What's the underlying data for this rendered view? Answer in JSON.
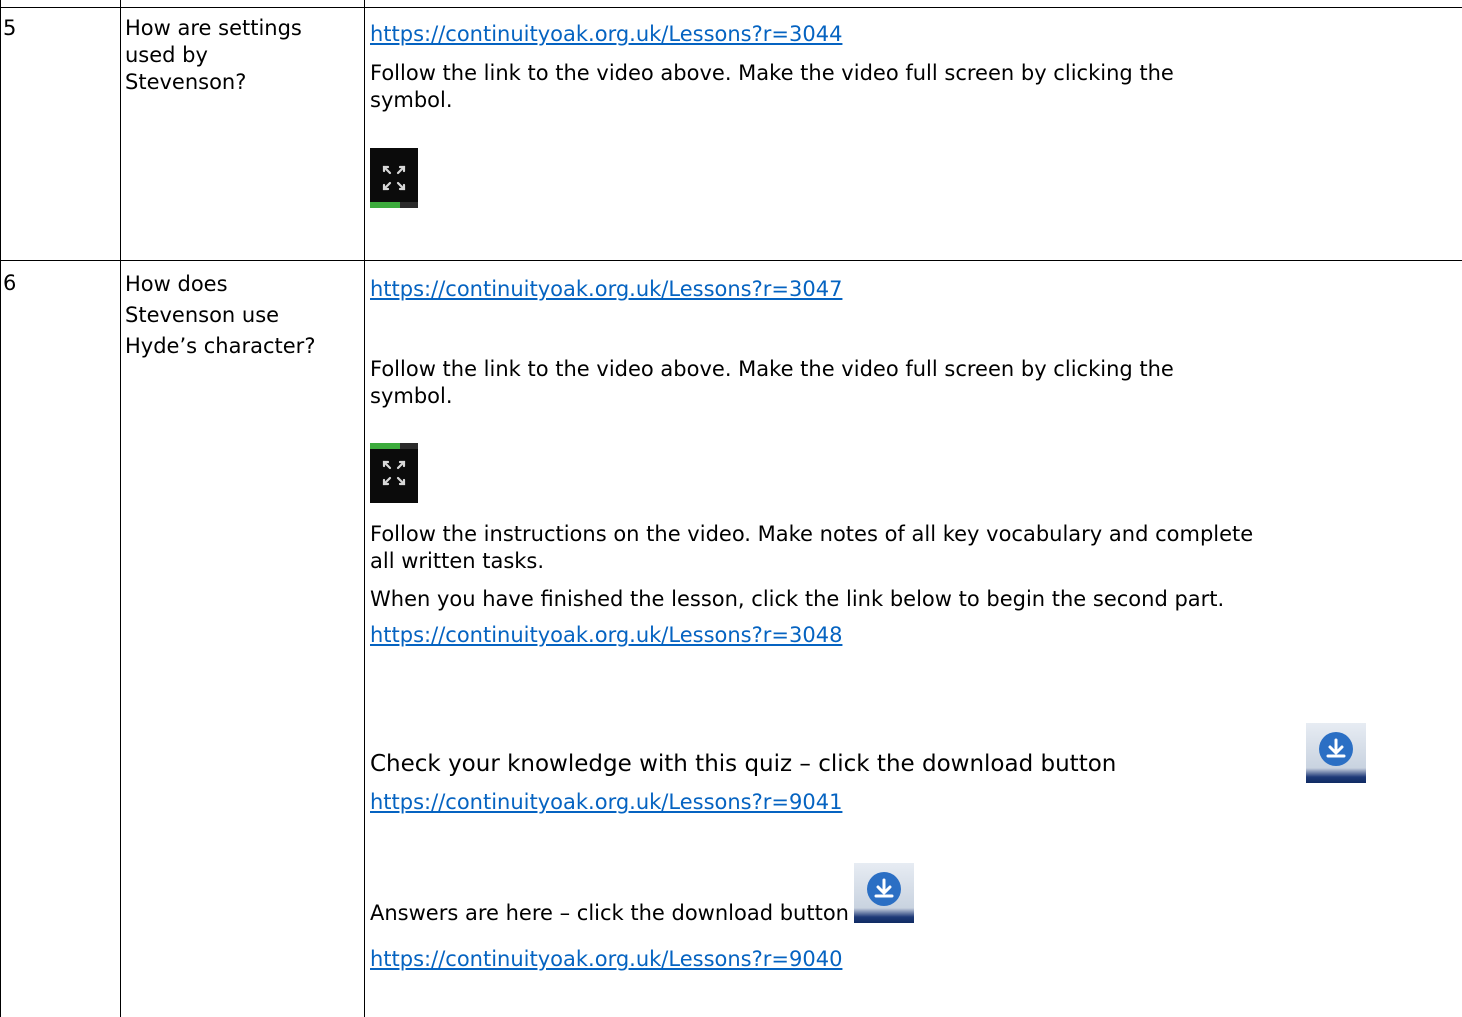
{
  "rows": [
    {
      "number": "5",
      "question": [
        "How are settings",
        "used by",
        "Stevenson?"
      ],
      "link": "https://continuityoak.org.uk/Lessons?r=3044",
      "instruction": [
        "Follow the link to the video above. Make the video full screen by clicking the",
        "symbol."
      ]
    },
    {
      "number": "6",
      "question": [
        "How does",
        "Stevenson use",
        "Hyde’s character?"
      ],
      "link": "https://continuityoak.org.uk/Lessons?r=3047",
      "instruction": [
        "Follow the link to the video above. Make the video full screen by clicking the",
        "symbol."
      ],
      "notes": [
        "Follow the instructions on the video. Make notes of all key vocabulary and complete",
        "all written tasks."
      ],
      "finished": "When you have finished the lesson, click the link below to begin the second part.",
      "second_link": "https://continuityoak.org.uk/Lessons?r=3048",
      "quiz_text": "Check your knowledge with this quiz – click the download button",
      "quiz_link": "https://continuityoak.org.uk/Lessons?r=9041",
      "answers_text": "Answers are here – click the download button",
      "answers_link": "https://continuityoak.org.uk/Lessons?r=9040"
    }
  ],
  "icons": {
    "fullscreen": "expand-arrows-icon",
    "download": "download-icon"
  },
  "colors": {
    "link": "#0563c1",
    "icon_dark": "#0b0b0b",
    "icon_green": "#3cab3c",
    "download_blue": "#2b6fc4"
  }
}
